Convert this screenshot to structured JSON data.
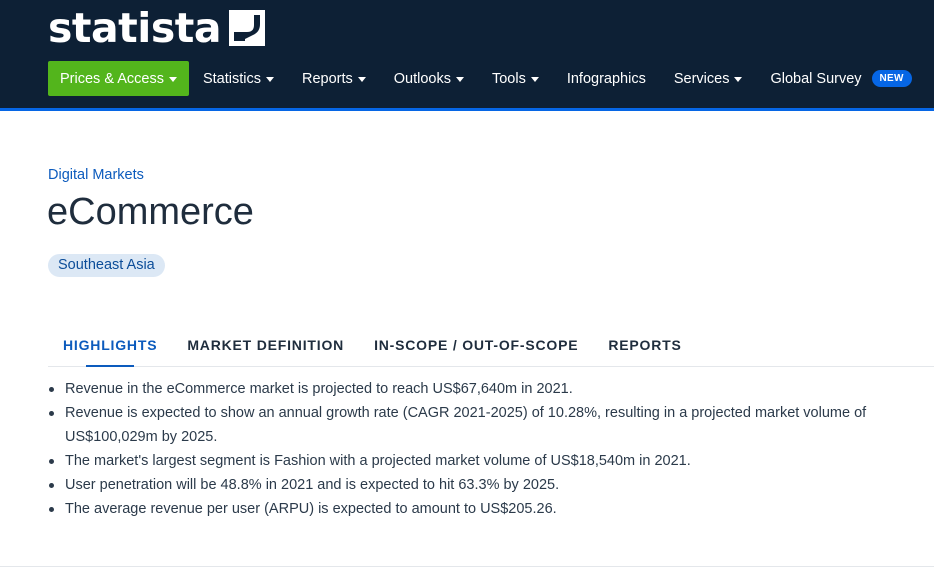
{
  "brand": {
    "name": "statista",
    "logo_icon": "statista-mark-icon"
  },
  "nav": {
    "items": [
      {
        "label": "Prices & Access",
        "dropdown": true,
        "active": true
      },
      {
        "label": "Statistics",
        "dropdown": true
      },
      {
        "label": "Reports",
        "dropdown": true
      },
      {
        "label": "Outlooks",
        "dropdown": true
      },
      {
        "label": "Tools",
        "dropdown": true
      },
      {
        "label": "Infographics",
        "dropdown": false
      },
      {
        "label": "Services",
        "dropdown": true
      },
      {
        "label": "Global Survey",
        "dropdown": false,
        "badge": "NEW"
      }
    ]
  },
  "page": {
    "breadcrumb": "Digital Markets",
    "title": "eCommerce",
    "region": "Southeast Asia"
  },
  "tabs": [
    {
      "label": "HIGHLIGHTS",
      "active": true
    },
    {
      "label": "MARKET DEFINITION"
    },
    {
      "label": "IN-SCOPE / OUT-OF-SCOPE"
    },
    {
      "label": "REPORTS"
    }
  ],
  "highlights": [
    "Revenue in the eCommerce market is projected to reach US$67,640m in 2021.",
    "Revenue is expected to show an annual growth rate (CAGR 2021-2025) of 10.28%, resulting in a projected market volume of US$100,029m by 2025.",
    "The market's largest segment is Fashion with a projected market volume of US$18,540m in 2021.",
    "User penetration will be 48.8% in 2021 and is expected to hit 63.3% by 2025.",
    "The average revenue per user (ARPU) is expected to amount to US$205.26."
  ],
  "colors": {
    "header_bg": "#0d2035",
    "header_accent": "#0666e5",
    "active_nav": "#53b51c",
    "link": "#0c5bbd",
    "region_tag_bg": "#dce8f5"
  }
}
